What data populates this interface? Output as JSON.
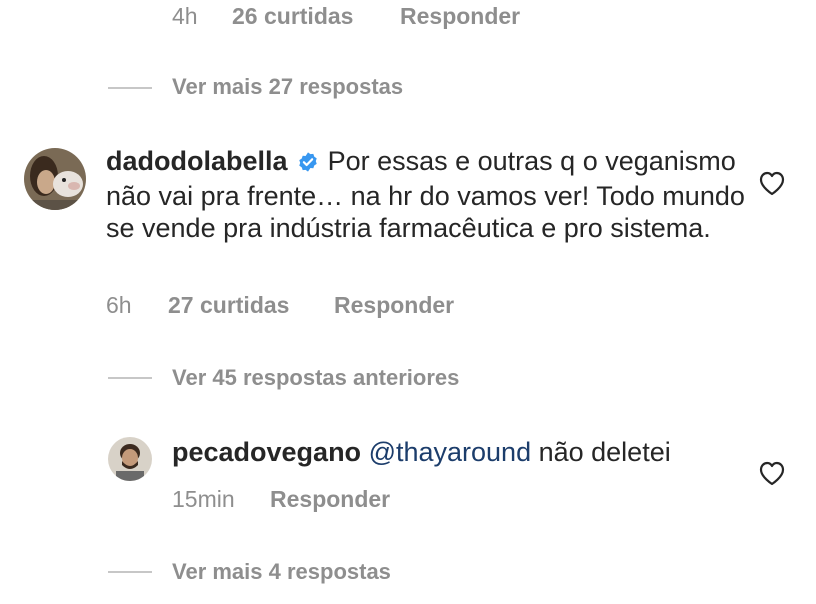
{
  "top_comment": {
    "time": "4h",
    "likes": "26 curtidas",
    "reply": "Responder"
  },
  "view_more_1": "Ver mais 27 respostas",
  "comment_1": {
    "username": "dadodolabella",
    "verified": true,
    "text": "Por essas e outras q o veganismo não vai pra frente… na hr do vamos ver! Todo mundo se vende pra indústria farmacêutica e pro sistema.",
    "time": "6h",
    "likes": "27 curtidas",
    "reply": "Responder",
    "heart_icon": "heart-outline-icon"
  },
  "view_previous": "Ver 45 respostas anteriores",
  "reply_1": {
    "username": "pecadovegano",
    "mention": "@thayaround",
    "text": " não deletei",
    "time": "15min",
    "reply": "Responder",
    "heart_icon": "heart-outline-icon"
  },
  "view_more_2": "Ver mais 4 respostas",
  "colors": {
    "verified_badge": "#3897f0",
    "meta_text": "#8e8e8e",
    "mention": "#1c3d6b"
  }
}
